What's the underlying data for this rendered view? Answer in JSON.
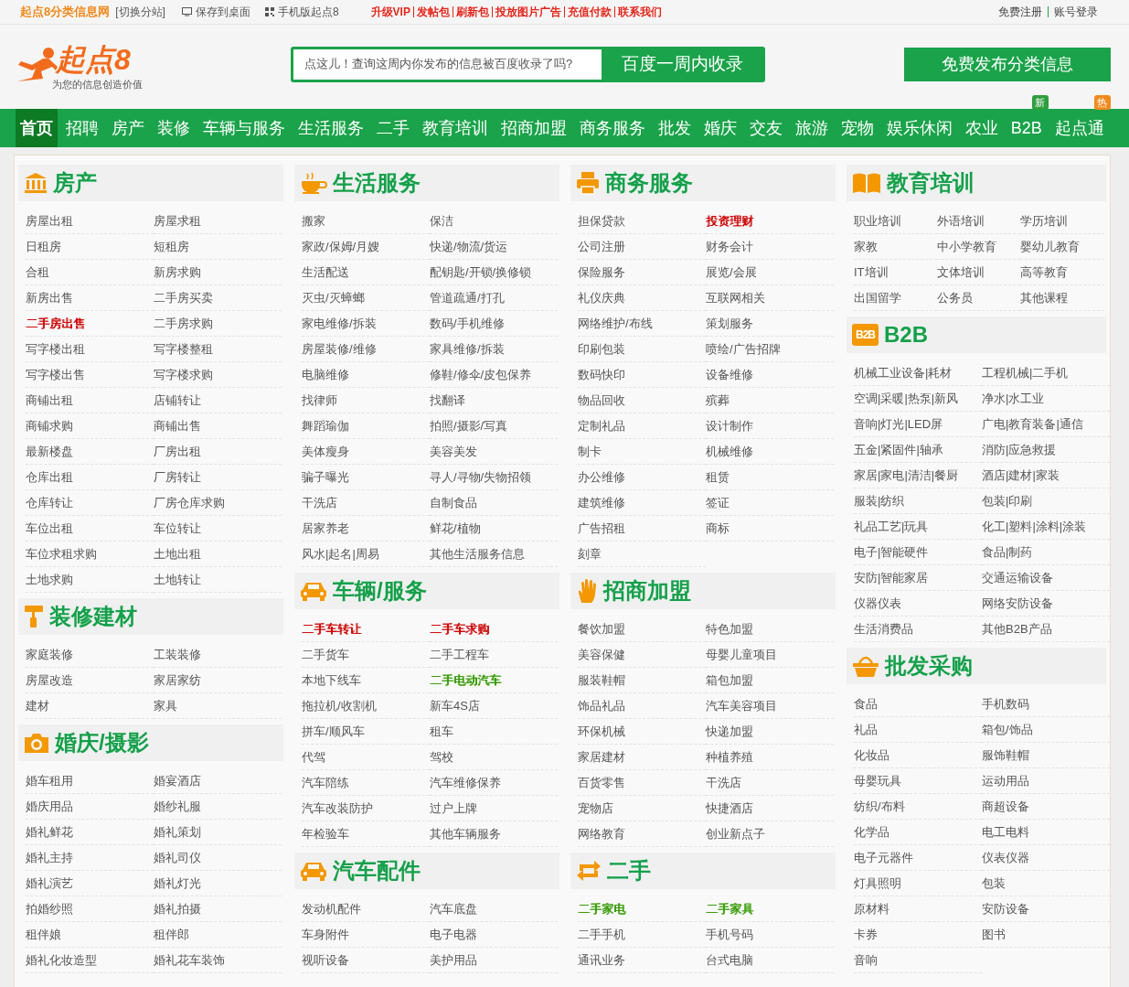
{
  "top_bar": {
    "site_name": "起点8分类信息网",
    "switch_link": "[切换分站]",
    "tools": [
      {
        "label": "保存到桌面"
      },
      {
        "label": "手机版起点8"
      }
    ],
    "promo_links": [
      "升级VIP",
      "发帖包",
      "刷新包",
      "投放图片广告",
      "充值付款",
      "联系我们"
    ],
    "account_links": [
      "免费注册",
      "账号登录"
    ]
  },
  "header": {
    "logo_text": "起点8",
    "slogan": "为您的信息创造价值",
    "search": {
      "placeholder": "点这儿！查询这周内你发布的信息被百度收录了吗?",
      "button": "百度一周内收录"
    },
    "publish_button": "免费发布分类信息"
  },
  "nav": [
    {
      "label": "首页",
      "selected": true
    },
    {
      "label": "招聘",
      "selected": false
    },
    {
      "label": "房产",
      "selected": false
    },
    {
      "label": "装修",
      "selected": false
    },
    {
      "label": "车辆与服务",
      "selected": false
    },
    {
      "label": "生活服务",
      "selected": false
    },
    {
      "label": "二手",
      "selected": false
    },
    {
      "label": "教育培训",
      "selected": false
    },
    {
      "label": "招商加盟",
      "selected": false
    },
    {
      "label": "商务服务",
      "selected": false
    },
    {
      "label": "批发",
      "selected": false
    },
    {
      "label": "婚庆",
      "selected": false
    },
    {
      "label": "交友",
      "selected": false
    },
    {
      "label": "旅游",
      "selected": false
    },
    {
      "label": "宠物",
      "selected": false
    },
    {
      "label": "娱乐休闲",
      "selected": false
    },
    {
      "label": "农业",
      "selected": false
    },
    {
      "label": "B2B",
      "selected": false,
      "badge": {
        "text": "新",
        "color": "#2e9e3e"
      }
    },
    {
      "label": "起点通",
      "selected": false,
      "badge": {
        "text": "热",
        "color": "#f08a1c"
      }
    }
  ],
  "columns": [
    {
      "sections": [
        {
          "title": "房产",
          "items": [
            {
              "label": "房屋出租"
            },
            {
              "label": "房屋求租"
            },
            {
              "label": "日租房"
            },
            {
              "label": "短租房"
            },
            {
              "label": "合租"
            },
            {
              "label": "新房求购"
            },
            {
              "label": "新房出售"
            },
            {
              "label": "二手房买卖"
            },
            {
              "label": "二手房出售",
              "color": "#cc0000"
            },
            {
              "label": "二手房求购"
            },
            {
              "label": "写字楼出租"
            },
            {
              "label": "写字楼整租"
            },
            {
              "label": "写字楼出售"
            },
            {
              "label": "写字楼求购"
            },
            {
              "label": "商铺出租"
            },
            {
              "label": "店铺转让"
            },
            {
              "label": "商铺求购"
            },
            {
              "label": "商铺出售"
            },
            {
              "label": "最新楼盘"
            },
            {
              "label": "厂房出租"
            },
            {
              "label": "仓库出租"
            },
            {
              "label": "厂房转让"
            },
            {
              "label": "仓库转让"
            },
            {
              "label": "厂房仓库求购"
            },
            {
              "label": "车位出租"
            },
            {
              "label": "车位转让"
            },
            {
              "label": "车位求租求购"
            },
            {
              "label": "土地出租"
            },
            {
              "label": "土地求购"
            },
            {
              "label": "土地转让"
            }
          ]
        },
        {
          "title": "装修建材",
          "items": [
            {
              "label": "家庭装修"
            },
            {
              "label": "工装装修"
            },
            {
              "label": "房屋改造"
            },
            {
              "label": "家居家纺"
            },
            {
              "label": "建材"
            },
            {
              "label": "家具"
            }
          ]
        },
        {
          "title": "婚庆/摄影",
          "items": [
            {
              "label": "婚车租用"
            },
            {
              "label": "婚宴酒店"
            },
            {
              "label": "婚庆用品"
            },
            {
              "label": "婚纱礼服"
            },
            {
              "label": "婚礼鲜花"
            },
            {
              "label": "婚礼策划"
            },
            {
              "label": "婚礼主持"
            },
            {
              "label": "婚礼司仪"
            },
            {
              "label": "婚礼演艺"
            },
            {
              "label": "婚礼灯光"
            },
            {
              "label": "拍婚纱照"
            },
            {
              "label": "婚礼拍摄"
            },
            {
              "label": "租伴娘"
            },
            {
              "label": "租伴郎"
            },
            {
              "label": "婚礼化妆造型"
            },
            {
              "label": "婚礼花车装饰"
            }
          ]
        }
      ]
    },
    {
      "sections": [
        {
          "title": "生活服务",
          "items": [
            {
              "label": "搬家"
            },
            {
              "label": "保洁"
            },
            {
              "label": "家政/保姆/月嫂"
            },
            {
              "label": "快递/物流/货运"
            },
            {
              "label": "生活配送"
            },
            {
              "label": "配钥匙/开锁/换修锁"
            },
            {
              "label": "灭虫/灭蟑螂"
            },
            {
              "label": "管道疏通/打孔"
            },
            {
              "label": "家电维修/拆装"
            },
            {
              "label": "数码/手机维修"
            },
            {
              "label": "房屋装修/维修"
            },
            {
              "label": "家具维修/拆装"
            },
            {
              "label": "电脑维修"
            },
            {
              "label": "修鞋/修伞/皮包保养"
            },
            {
              "label": "找律师"
            },
            {
              "label": "找翻译"
            },
            {
              "label": "舞蹈瑜伽"
            },
            {
              "label": "拍照/摄影/写真"
            },
            {
              "label": "美体瘦身"
            },
            {
              "label": "美容美发"
            },
            {
              "label": "骗子曝光"
            },
            {
              "label": "寻人/寻物/失物招领"
            },
            {
              "label": "干洗店"
            },
            {
              "label": "自制食品"
            },
            {
              "label": "居家养老"
            },
            {
              "label": "鲜花/植物"
            },
            {
              "label": "风水|起名|周易"
            },
            {
              "label": "其他生活服务信息"
            }
          ]
        },
        {
          "title": "车辆/服务",
          "items": [
            {
              "label": "二手车转让",
              "color": "#cc0000"
            },
            {
              "label": "二手车求购",
              "color": "#cc0000"
            },
            {
              "label": "二手货车"
            },
            {
              "label": "二手工程车"
            },
            {
              "label": "本地下线车"
            },
            {
              "label": "二手电动汽车",
              "color": "#339900"
            },
            {
              "label": "拖拉机/收割机"
            },
            {
              "label": "新车4S店"
            },
            {
              "label": "拼车/顺风车"
            },
            {
              "label": "租车"
            },
            {
              "label": "代驾"
            },
            {
              "label": "驾校"
            },
            {
              "label": "汽车陪练"
            },
            {
              "label": "汽车维修保养"
            },
            {
              "label": "汽车改装防护"
            },
            {
              "label": "过户上牌"
            },
            {
              "label": "年检验车"
            },
            {
              "label": "其他车辆服务"
            }
          ]
        },
        {
          "title": "汽车配件",
          "items": [
            {
              "label": "发动机配件"
            },
            {
              "label": "汽车底盘"
            },
            {
              "label": "车身附件"
            },
            {
              "label": "电子电器"
            },
            {
              "label": "视听设备"
            },
            {
              "label": "美护用品"
            }
          ]
        }
      ]
    },
    {
      "sections": [
        {
          "title": "商务服务",
          "items": [
            {
              "label": "担保贷款"
            },
            {
              "label": "投资理财",
              "color": "#cc0000"
            },
            {
              "label": "公司注册"
            },
            {
              "label": "财务会计"
            },
            {
              "label": "保险服务"
            },
            {
              "label": "展览/会展"
            },
            {
              "label": "礼仪庆典"
            },
            {
              "label": "互联网相关"
            },
            {
              "label": "网络维护/布线"
            },
            {
              "label": "策划服务"
            },
            {
              "label": "印刷包装"
            },
            {
              "label": "喷绘/广告招牌"
            },
            {
              "label": "数码快印"
            },
            {
              "label": "设备维修"
            },
            {
              "label": "物品回收"
            },
            {
              "label": "殡葬"
            },
            {
              "label": "定制礼品"
            },
            {
              "label": "设计制作"
            },
            {
              "label": "制卡"
            },
            {
              "label": "机械维修"
            },
            {
              "label": "办公维修"
            },
            {
              "label": "租赁"
            },
            {
              "label": "建筑维修"
            },
            {
              "label": "签证"
            },
            {
              "label": "广告招租"
            },
            {
              "label": "商标"
            },
            {
              "label": "刻章"
            }
          ]
        },
        {
          "title": "招商加盟",
          "items": [
            {
              "label": "餐饮加盟"
            },
            {
              "label": "特色加盟"
            },
            {
              "label": "美容保健"
            },
            {
              "label": "母婴儿童项目"
            },
            {
              "label": "服装鞋帽"
            },
            {
              "label": "箱包加盟"
            },
            {
              "label": "饰品礼品"
            },
            {
              "label": "汽车美容项目"
            },
            {
              "label": "环保机械"
            },
            {
              "label": "快递加盟"
            },
            {
              "label": "家居建材"
            },
            {
              "label": "种植养殖"
            },
            {
              "label": "百货零售"
            },
            {
              "label": "干洗店"
            },
            {
              "label": "宠物店"
            },
            {
              "label": "快捷酒店"
            },
            {
              "label": "网络教育"
            },
            {
              "label": "创业新点子"
            }
          ]
        },
        {
          "title": "二手",
          "items": [
            {
              "label": "二手家电",
              "color": "#339900"
            },
            {
              "label": "二手家具",
              "color": "#339900"
            },
            {
              "label": "二手手机"
            },
            {
              "label": "手机号码"
            },
            {
              "label": "通讯业务"
            },
            {
              "label": "台式电脑"
            }
          ]
        }
      ]
    },
    {
      "sections": [
        {
          "title": "教育培训",
          "items": [
            {
              "label": "职业培训"
            },
            {
              "label": "外语培训"
            },
            {
              "label": "学历培训"
            },
            {
              "label": "家教"
            },
            {
              "label": "中小学教育"
            },
            {
              "label": "婴幼儿教育"
            },
            {
              "label": "IT培训"
            },
            {
              "label": "文体培训"
            },
            {
              "label": "高等教育"
            },
            {
              "label": "出国留学"
            },
            {
              "label": "公务员"
            },
            {
              "label": "其他课程"
            }
          ]
        },
        {
          "title": "B2B",
          "icon_text": "B2B",
          "items": [
            {
              "label": "机械工业设备|耗材"
            },
            {
              "label": "工程机械|二手机"
            },
            {
              "label": "空调|采暖|热泵|新风"
            },
            {
              "label": "净水|水工业"
            },
            {
              "label": "音响|灯光|LED屏"
            },
            {
              "label": "广电|教育装备|通信"
            },
            {
              "label": "五金|紧固件|轴承"
            },
            {
              "label": "消防|应急救援"
            },
            {
              "label": "家居|家电|清洁|餐厨"
            },
            {
              "label": "酒店|建材|家装"
            },
            {
              "label": "服装|纺织"
            },
            {
              "label": "包装|印刷"
            },
            {
              "label": "礼品工艺|玩具"
            },
            {
              "label": "化工|塑料|涂料|涂装"
            },
            {
              "label": "电子|智能硬件"
            },
            {
              "label": "食品|制药"
            },
            {
              "label": "安防|智能家居"
            },
            {
              "label": "交通运输设备"
            },
            {
              "label": "仪器仪表"
            },
            {
              "label": "网络安防设备"
            },
            {
              "label": "生活消费品"
            },
            {
              "label": "其他B2B产品"
            }
          ]
        },
        {
          "title": "批发采购",
          "items": [
            {
              "label": "食品"
            },
            {
              "label": "手机数码"
            },
            {
              "label": "礼品"
            },
            {
              "label": "箱包/饰品"
            },
            {
              "label": "化妆品"
            },
            {
              "label": "服饰鞋帽"
            },
            {
              "label": "母婴玩具"
            },
            {
              "label": "运动用品"
            },
            {
              "label": "纺织/布料"
            },
            {
              "label": "商超设备"
            },
            {
              "label": "化学品"
            },
            {
              "label": "电工电料"
            },
            {
              "label": "电子元器件"
            },
            {
              "label": "仪表仪器"
            },
            {
              "label": "灯具照明"
            },
            {
              "label": "包装"
            },
            {
              "label": "原材料"
            },
            {
              "label": "安防设备"
            },
            {
              "label": "卡券"
            },
            {
              "label": "图书"
            },
            {
              "label": "音响"
            }
          ]
        }
      ]
    }
  ]
}
